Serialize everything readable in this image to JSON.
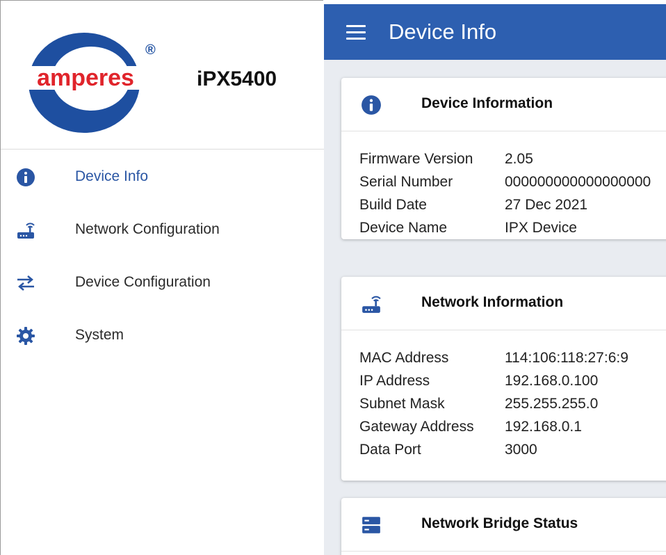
{
  "brand": {
    "logo_text": "amperes",
    "registered": "®",
    "model": "iPX5400"
  },
  "sidebar": {
    "items": [
      {
        "label": "Device Info",
        "icon": "info-icon",
        "active": true
      },
      {
        "label": "Network Configuration",
        "icon": "router-icon",
        "active": false
      },
      {
        "label": "Device Configuration",
        "icon": "swap-arrows-icon",
        "active": false
      },
      {
        "label": "System",
        "icon": "gear-icon",
        "active": false
      }
    ]
  },
  "header": {
    "title": "Device Info",
    "menu_icon": "hamburger-menu-icon"
  },
  "cards": [
    {
      "title": "Device Information",
      "icon": "info-icon",
      "rows": [
        {
          "key": "Firmware Version",
          "value": "2.05"
        },
        {
          "key": "Serial Number",
          "value": "000000000000000000"
        },
        {
          "key": "Build Date",
          "value": "27 Dec 2021"
        },
        {
          "key": "Device Name",
          "value": "IPX Device"
        }
      ]
    },
    {
      "title": "Network Information",
      "icon": "router-icon",
      "rows": [
        {
          "key": "MAC Address",
          "value": "114:106:118:27:6:9"
        },
        {
          "key": "IP Address",
          "value": "192.168.0.100"
        },
        {
          "key": "Subnet Mask",
          "value": "255.255.255.0"
        },
        {
          "key": "Gateway Address",
          "value": "192.168.0.1"
        },
        {
          "key": "Data Port",
          "value": "3000"
        }
      ]
    },
    {
      "title": "Network Bridge Status",
      "icon": "server-icon",
      "rows": []
    }
  ],
  "colors": {
    "primary": "#2d5fb0",
    "logo_red": "#e0242b",
    "logo_blue": "#1e4fa0",
    "background": "#e9ecf1"
  }
}
